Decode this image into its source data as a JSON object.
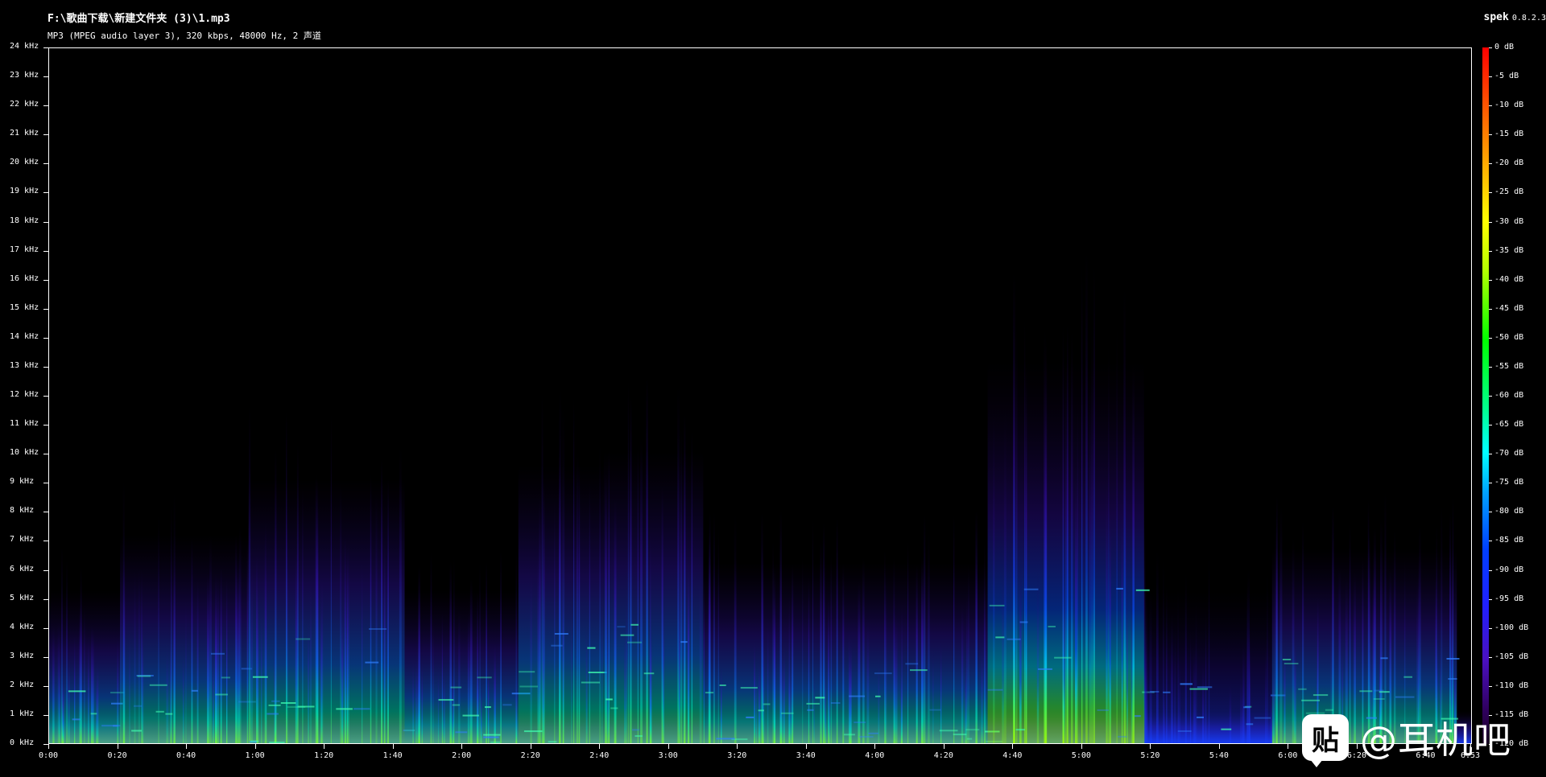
{
  "header": {
    "file_path": "F:\\歌曲下载\\新建文件夹 (3)\\1.mp3",
    "file_info": "MP3 (MPEG audio layer 3), 320 kbps, 48000 Hz, 2 声道"
  },
  "brand": {
    "name": "spek",
    "version": "0.8.2.3"
  },
  "y_axis": {
    "labels": [
      "0 kHz",
      "1 kHz",
      "2 kHz",
      "3 kHz",
      "4 kHz",
      "5 kHz",
      "6 kHz",
      "7 kHz",
      "8 kHz",
      "9 kHz",
      "10 kHz",
      "11 kHz",
      "12 kHz",
      "13 kHz",
      "14 kHz",
      "15 kHz",
      "16 kHz",
      "17 kHz",
      "18 kHz",
      "19 kHz",
      "20 kHz",
      "21 kHz",
      "22 kHz",
      "23 kHz",
      "24 kHz"
    ],
    "max_khz": 24
  },
  "x_axis": {
    "labels": [
      "0:00",
      "0:20",
      "0:40",
      "1:00",
      "1:20",
      "1:40",
      "2:00",
      "2:20",
      "2:40",
      "3:00",
      "3:20",
      "3:40",
      "4:00",
      "4:20",
      "4:40",
      "5:00",
      "5:20",
      "5:40",
      "6:00",
      "6:20",
      "6:40",
      "6:53"
    ],
    "seconds": [
      0,
      20,
      40,
      60,
      80,
      100,
      120,
      140,
      160,
      180,
      200,
      220,
      240,
      260,
      280,
      300,
      320,
      340,
      360,
      380,
      400,
      413
    ],
    "duration_seconds": 413
  },
  "colorbar": {
    "labels": [
      "0 dB",
      "-5 dB",
      "-10 dB",
      "-15 dB",
      "-20 dB",
      "-25 dB",
      "-30 dB",
      "-35 dB",
      "-40 dB",
      "-45 dB",
      "-50 dB",
      "-55 dB",
      "-60 dB",
      "-65 dB",
      "-70 dB",
      "-75 dB",
      "-80 dB",
      "-85 dB",
      "-90 dB",
      "-95 dB",
      "-100 dB",
      "-105 dB",
      "-110 dB",
      "-115 dB",
      "-120 dB"
    ]
  },
  "watermark": {
    "icon_glyph": "贴",
    "text": "@耳机吧"
  },
  "colors": {
    "background": "#000000",
    "axis": "#ffffff"
  }
}
